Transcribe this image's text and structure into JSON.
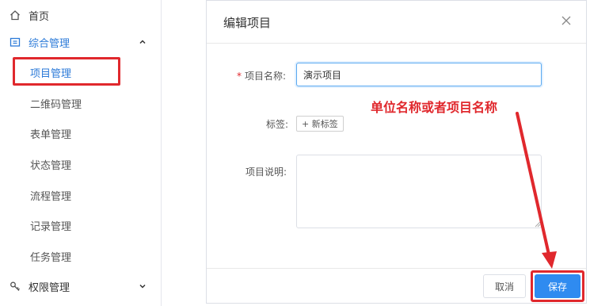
{
  "sidebar": {
    "home": {
      "label": "首页",
      "icon": "home-icon"
    },
    "general": {
      "label": "综合管理",
      "icon": "folder-icon",
      "expand_icon": "chevron-up-icon"
    },
    "items": [
      {
        "label": "项目管理",
        "active": true
      },
      {
        "label": "二维码管理"
      },
      {
        "label": "表单管理"
      },
      {
        "label": "状态管理"
      },
      {
        "label": "流程管理"
      },
      {
        "label": "记录管理"
      },
      {
        "label": "任务管理"
      }
    ],
    "permissions": {
      "label": "权限管理",
      "icon": "key-icon",
      "expand_icon": "chevron-down-icon"
    }
  },
  "modal": {
    "title": "编辑项目",
    "close_icon": "close-icon",
    "fields": {
      "name": {
        "required_mark": "*",
        "label": "项目名称:",
        "value": "演示项目"
      },
      "tags": {
        "label": "标签:",
        "add_button": "+ 新标签"
      },
      "description": {
        "label": "项目说明:",
        "value": ""
      }
    },
    "annotation": "单位名称或者项目名称",
    "buttons": {
      "cancel": "取消",
      "save": "保存"
    }
  },
  "colors": {
    "accent": "#2b7ad8",
    "primary_button": "#2f8bf0",
    "annotation_red": "#e0282d",
    "input_focus_border": "#5aa9f0"
  }
}
